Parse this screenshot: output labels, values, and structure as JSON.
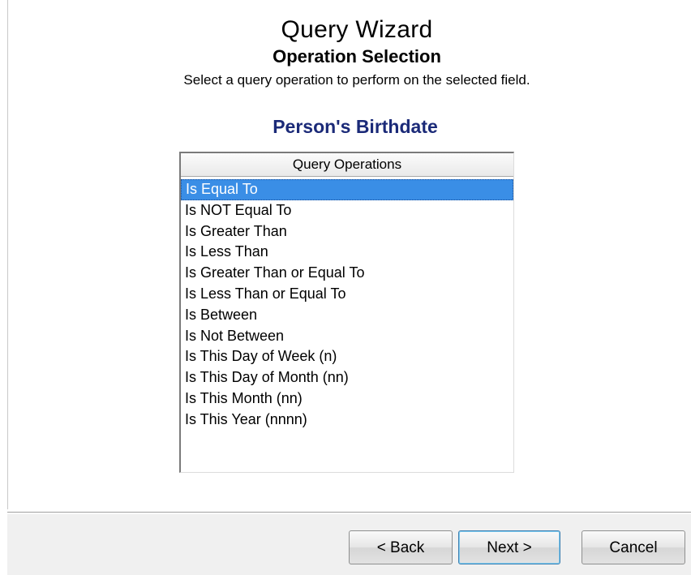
{
  "wizard": {
    "title": "Query Wizard",
    "subtitle": "Operation Selection",
    "description": "Select a query operation to perform on the selected field."
  },
  "field": {
    "name": "Person's Birthdate"
  },
  "list": {
    "header": "Query Operations",
    "selected_index": 0,
    "items": [
      "Is Equal To",
      "Is NOT Equal To",
      "Is Greater Than",
      "Is Less Than",
      "Is Greater Than or Equal To",
      "Is Less Than or Equal To",
      "Is Between",
      "Is Not Between",
      "Is This Day of Week (n)",
      "Is This Day of Month (nn)",
      "Is This Month (nn)",
      "Is This Year (nnnn)"
    ]
  },
  "buttons": {
    "back": "< Back",
    "next": "Next >",
    "cancel": "Cancel"
  },
  "colors": {
    "selection": "#3a8ee6",
    "field_name": "#1b2a78"
  }
}
